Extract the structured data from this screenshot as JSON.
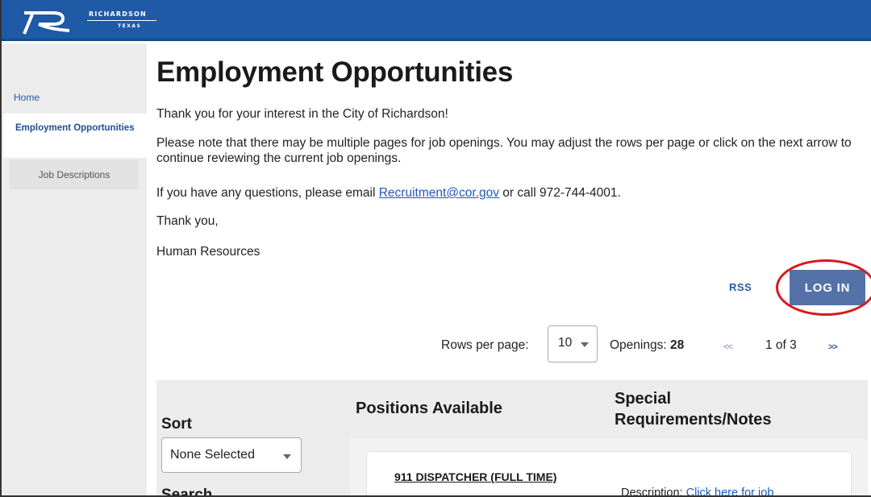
{
  "header": {
    "logo_name": "RICHARDSON",
    "logo_sub": "TEXAS",
    "colors": {
      "bar": "#1f5aa6"
    }
  },
  "sidebar": {
    "items": [
      {
        "label": "Home"
      },
      {
        "label": "Employment Opportunities"
      },
      {
        "label": "Job Descriptions"
      }
    ]
  },
  "main": {
    "title": "Employment Opportunities",
    "para1": "Thank you for your interest in the City of Richardson!",
    "para2": "Please note that there may be multiple pages for job openings. You may adjust the rows per page or click on the next arrow to continue reviewing the current job openings.",
    "para3_before": "If you have any questions, please email ",
    "para3_email": "Recruitment@cor.gov",
    "para3_after": " or call 972-744-4001.",
    "para4": "Thank you,",
    "para5": "Human Resources"
  },
  "actions": {
    "rss_label": "RSS",
    "login_label": "LOG IN",
    "highlight_color": "#d8191f"
  },
  "pager": {
    "rows_label": "Rows per page:",
    "rows_value": "10",
    "openings_label": "Openings: ",
    "openings_count": "28",
    "prev_label": "<<",
    "page_text": "1 of 3",
    "next_label": ">>"
  },
  "table": {
    "sort_label": "Sort",
    "sort_value": "None Selected",
    "search_label": "Search",
    "positions_header": "Positions Available",
    "notes_header": "Special Requirements/Notes",
    "rows": [
      {
        "title": "911 DISPATCHER (FULL TIME)",
        "desc_label": "Description: ",
        "desc_link": "Click here for job"
      }
    ]
  }
}
